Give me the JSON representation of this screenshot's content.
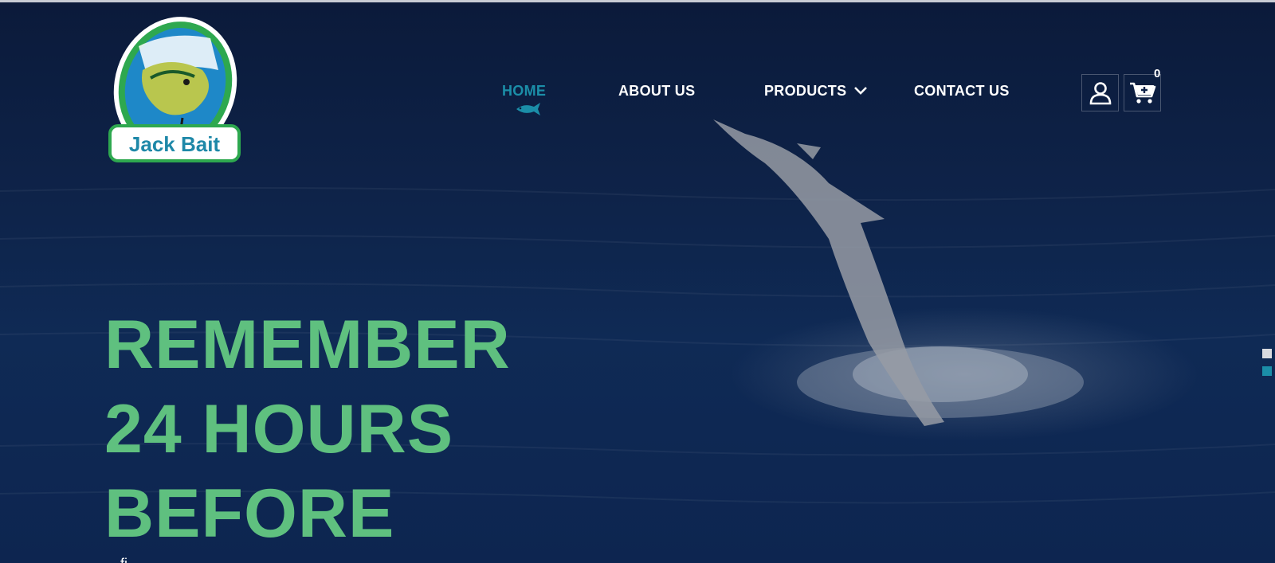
{
  "brand": {
    "name": "Jack Bait"
  },
  "nav": {
    "items": [
      {
        "label": "HOME",
        "active": true
      },
      {
        "label": "ABOUT US",
        "active": false
      },
      {
        "label": "PRODUCTS",
        "active": false,
        "has_dropdown": true
      },
      {
        "label": "CONTACT US",
        "active": false
      }
    ]
  },
  "header_actions": {
    "account_icon": "user-icon",
    "cart_icon": "cart-icon",
    "cart_count": "0"
  },
  "hero": {
    "headline_lines": [
      "REMEMBER",
      "24 HOURS",
      "BEFORE"
    ],
    "subtext": "... fi..."
  },
  "slider": {
    "dot_count": 2,
    "active_dot": 2
  },
  "colors": {
    "accent": "#1b8ea8",
    "headline": "#5fc07f",
    "background": "#0e2349"
  }
}
